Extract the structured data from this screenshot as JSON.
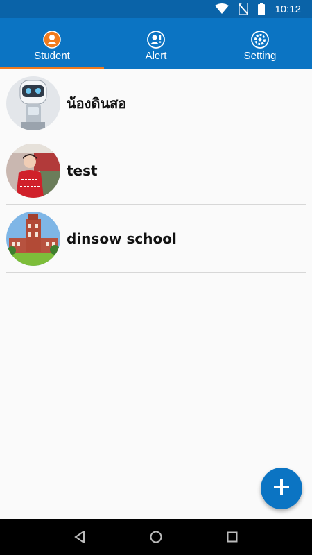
{
  "status_bar": {
    "time": "10:12",
    "icons": [
      "wifi-icon",
      "no-sim-icon",
      "battery-icon"
    ],
    "color": "#0a63a8"
  },
  "tabs": [
    {
      "label": "Student",
      "icon": "person-icon",
      "selected": true
    },
    {
      "label": "Alert",
      "icon": "alert-person-icon",
      "selected": false
    },
    {
      "label": "Setting",
      "icon": "gear-icon",
      "selected": false
    }
  ],
  "theme": {
    "primary": "#0b74c3",
    "tab_indicator": "#f07b1e",
    "active_tab_icon_bg": "#f07b1e"
  },
  "students": [
    {
      "name": "น้องดินสอ",
      "avatar": "robot-avatar"
    },
    {
      "name": "test",
      "avatar": "person-red-shirt-avatar"
    },
    {
      "name": "dinsow school",
      "avatar": "school-building-avatar"
    }
  ],
  "fab": {
    "icon": "plus-icon",
    "label": "+"
  },
  "nav": {
    "icons": [
      "back-icon",
      "home-icon",
      "recents-icon"
    ]
  }
}
